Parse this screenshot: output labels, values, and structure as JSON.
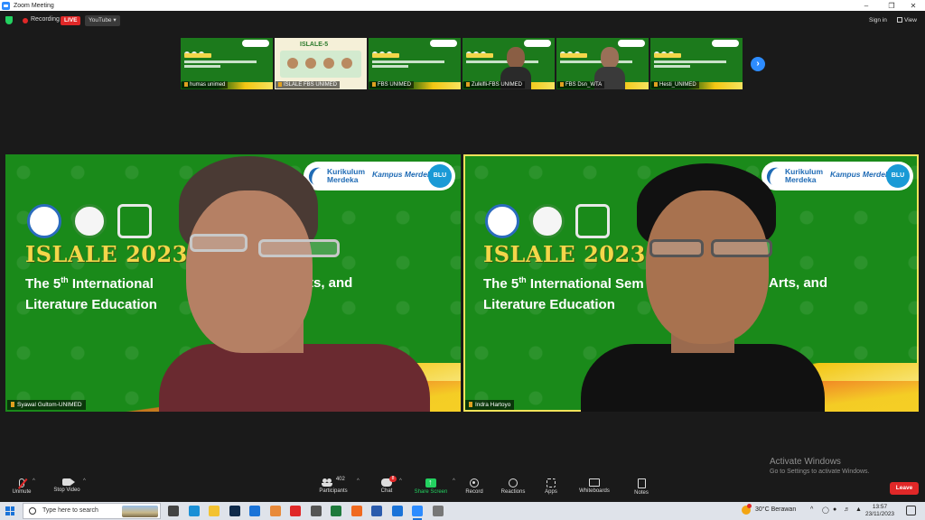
{
  "window": {
    "title": "Zoom Meeting"
  },
  "topbar": {
    "recording_label": "Recording",
    "live_label": "LIVE",
    "youtube_label": "YouTube ▾",
    "signin_label": "Sign in",
    "view_label": "View"
  },
  "thumbnails": [
    {
      "name": "humas unimed",
      "kind": "slide"
    },
    {
      "name": "ISLALE FBS UNIMED",
      "kind": "islale",
      "title": "ISLALE-5"
    },
    {
      "name": "FBS UNIMED",
      "kind": "slide"
    },
    {
      "name": "Zulkifli-FBS UNIMED",
      "kind": "person"
    },
    {
      "name": "FBS Dsn_WTA",
      "kind": "person"
    },
    {
      "name": "Hesti_UNIMED",
      "kind": "slide"
    }
  ],
  "tiles": [
    {
      "name": "Syawal Gultom-UNIMED",
      "banner_k1": "Kurikulum",
      "banner_k2": "Merdeka",
      "banner_kampus": "Kampus Merdeka",
      "banner_blu": "BLU",
      "islale": "ISLALE 2023",
      "line1_a": "The 5",
      "line1_sup": "th",
      "line1_b": " International",
      "line1_c": "ts, and",
      "line2": "Literature Education"
    },
    {
      "name": "Indra Hartoyo",
      "banner_k1": "Kurikulum",
      "banner_k2": "Merdeka",
      "banner_kampus": "Kampus Merdeka",
      "banner_blu": "BLU",
      "islale": "ISLALE 2023",
      "line1_a": "The 5",
      "line1_sup": "th",
      "line1_b": " International Sem",
      "line1_c": "Arts, and",
      "line2": "Literature Education"
    }
  ],
  "watermark": {
    "line1": "Activate Windows",
    "line2": "Go to Settings to activate Windows."
  },
  "toolbar": {
    "unmute": "Unmute",
    "stop_video": "Stop Video",
    "participants": "Participants",
    "participant_count": "402",
    "chat": "Chat",
    "chat_badge": "8",
    "share_screen": "Share Screen",
    "record": "Record",
    "reactions": "Reactions",
    "apps": "Apps",
    "whiteboards": "Whiteboards",
    "notes": "Notes",
    "leave": "Leave"
  },
  "taskbar": {
    "search_placeholder": "Type here to search",
    "weather": "30°C Berawan",
    "time": "13:57",
    "date": "23/11/2023",
    "apps": [
      {
        "name": "task-view",
        "color": "#444444"
      },
      {
        "name": "edge",
        "color": "#1a8fd6"
      },
      {
        "name": "file-explorer",
        "color": "#f3c230"
      },
      {
        "name": "photoshop",
        "color": "#0f2a4a"
      },
      {
        "name": "mail",
        "color": "#1a73d8"
      },
      {
        "name": "paint",
        "color": "#e88a3a"
      },
      {
        "name": "opera",
        "color": "#e02828"
      },
      {
        "name": "whatsapp",
        "color": "#555555"
      },
      {
        "name": "excel",
        "color": "#1e7a3c"
      },
      {
        "name": "firefox",
        "color": "#f06a20"
      },
      {
        "name": "word",
        "color": "#2b5cad"
      },
      {
        "name": "photos",
        "color": "#1a73d8"
      },
      {
        "name": "zoom",
        "color": "#2D8CFF"
      },
      {
        "name": "usb",
        "color": "#777777"
      }
    ]
  }
}
